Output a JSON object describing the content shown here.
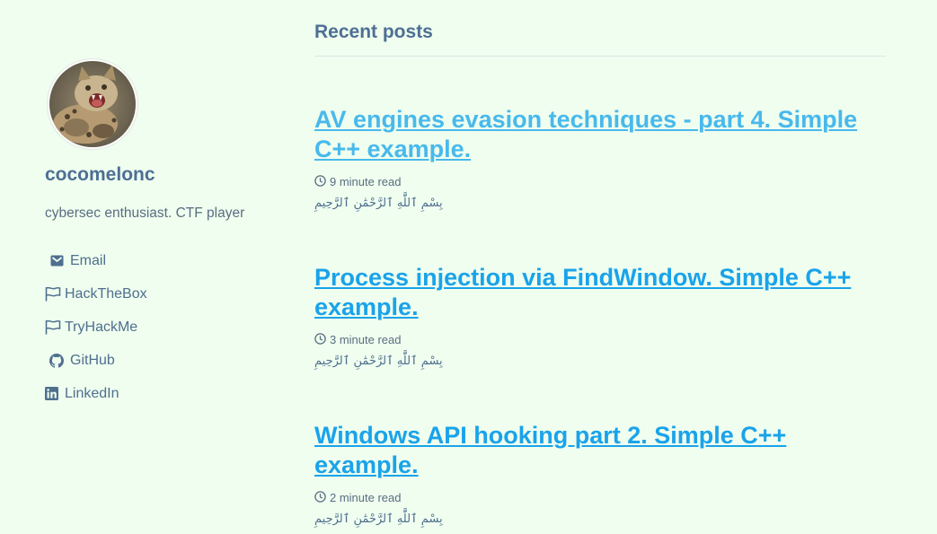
{
  "sidebar": {
    "author_name": "cocomelonc",
    "author_bio": "cybersec enthusiast. CTF player",
    "links": [
      {
        "label": "Email",
        "icon": "envelope-icon"
      },
      {
        "label": "HackTheBox",
        "icon": "flag-icon"
      },
      {
        "label": "TryHackMe",
        "icon": "flag-icon"
      },
      {
        "label": "GitHub",
        "icon": "github-icon"
      },
      {
        "label": "LinkedIn",
        "icon": "linkedin-icon"
      }
    ]
  },
  "main": {
    "section_title": "Recent posts",
    "posts": [
      {
        "title": "AV engines evasion techniques - part 4. Simple C++ example.",
        "read_time": "9 minute read",
        "excerpt": "بِسْمِ ٱللَّٰهِ ٱلرَّحْمَٰنِ ٱلرَّحِيمِ"
      },
      {
        "title": "Process injection via FindWindow. Simple C++ example.",
        "read_time": "3 minute read",
        "excerpt": "بِسْمِ ٱللَّٰهِ ٱلرَّحْمَٰنِ ٱلرَّحِيمِ"
      },
      {
        "title": "Windows API hooking part 2. Simple C++ example.",
        "read_time": "2 minute read",
        "excerpt": "بِسْمِ ٱللَّٰهِ ٱلرَّحْمَٰنِ ٱلرَّحِيمِ"
      }
    ]
  },
  "colors": {
    "background": "#effeef",
    "link": "#1aa3ea",
    "text": "#4f6f8f"
  }
}
